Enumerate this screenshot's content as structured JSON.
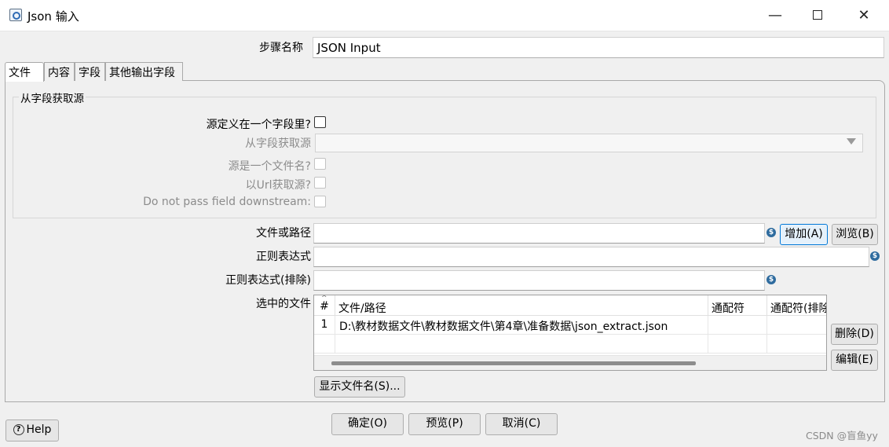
{
  "window": {
    "title": "Json 输入",
    "minimize_glyph": "—",
    "close_glyph": "✕"
  },
  "step": {
    "label": "步骤名称",
    "value": "JSON Input"
  },
  "tabs": [
    {
      "label": "文件"
    },
    {
      "label": "内容"
    },
    {
      "label": "字段"
    },
    {
      "label": "其他输出字段"
    }
  ],
  "source_group": {
    "title": "从字段获取源",
    "source_in_field_label": "源定义在一个字段里?",
    "source_field_label": "从字段获取源",
    "source_is_filename_label": "源是一个文件名?",
    "source_from_url_label": "以Url获取源?",
    "no_pass_field_label": "Do not pass field downstream:"
  },
  "file": {
    "path_label": "文件或路径",
    "add_button": "增加(A)",
    "browse_button": "浏览(B)",
    "regex_label": "正则表达式",
    "regex_exclude_label": "正则表达式(排除)",
    "selected_label": "选中的文件",
    "var_icon": "$"
  },
  "table": {
    "headers": [
      "#",
      "文件/路径",
      "通配符",
      "通配符(排除)"
    ],
    "sort_glyph": "^",
    "rows": [
      [
        "1",
        "D:\\教材数据文件\\教材数据文件\\第4章\\准备数据\\json_extract.json",
        "",
        ""
      ]
    ]
  },
  "buttons": {
    "delete": "删除(D)",
    "edit": "编辑(E)",
    "show_filenames": "显示文件名(S)...",
    "help": "Help",
    "help_glyph": "?",
    "ok": "确定(O)",
    "preview": "预览(P)",
    "cancel": "取消(C)"
  },
  "watermark": "CSDN @盲鱼yy"
}
